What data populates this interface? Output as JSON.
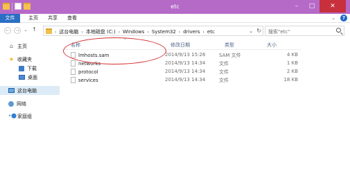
{
  "window": {
    "title": "etc"
  },
  "titlebar": {
    "minimize": "–",
    "maximize": "□",
    "close": "✕"
  },
  "ribbon": {
    "tabs": [
      "文件",
      "主页",
      "共享",
      "查看"
    ],
    "collapse": "⌄",
    "help": "?"
  },
  "nav": {
    "back": "←",
    "forward": "→",
    "recent": "⌄",
    "up": "↑",
    "breadcrumbs": [
      "这台电脑",
      "本地磁盘 (C:)",
      "Windows",
      "System32",
      "drivers",
      "etc"
    ],
    "separator": "›",
    "dropdown": "⌄",
    "refresh": "↻",
    "search_placeholder": "搜索\"etc\""
  },
  "sidebar": {
    "items": [
      {
        "label": "主页",
        "icon": "home-icon",
        "glyph": "⌂"
      },
      {
        "label": "收藏夹",
        "icon": "star-icon",
        "glyph": "★"
      },
      {
        "label": "下载",
        "icon": "download-folder-icon",
        "glyph": ""
      },
      {
        "label": "桌面",
        "icon": "desktop-icon",
        "glyph": ""
      },
      {
        "label": "这台电脑",
        "icon": "computer-icon",
        "glyph": ""
      },
      {
        "label": "网络",
        "icon": "network-icon",
        "glyph": ""
      },
      {
        "label": "家庭组",
        "icon": "homegroup-icon",
        "glyph": "•⬤"
      }
    ]
  },
  "columns": {
    "name": "名称",
    "modified": "修改日期",
    "type": "类型",
    "size": "大小",
    "sort_indicator": "^"
  },
  "files": [
    {
      "name": "lmhosts.sam",
      "modified": "2014/9/13 15:26",
      "type": "SAM 文件",
      "size": "4 KB"
    },
    {
      "name": "networks",
      "modified": "2014/9/13 14:34",
      "type": "文件",
      "size": "1 KB"
    },
    {
      "name": "protocol",
      "modified": "2014/9/13 14:34",
      "type": "文件",
      "size": "2 KB"
    },
    {
      "name": "services",
      "modified": "2014/9/13 14:34",
      "type": "文件",
      "size": "18 KB"
    }
  ],
  "colors": {
    "titlebar": "#b66ac8",
    "file_tab": "#2b6fc4",
    "close": "#c7303c",
    "annotation": "#d62c2c"
  }
}
